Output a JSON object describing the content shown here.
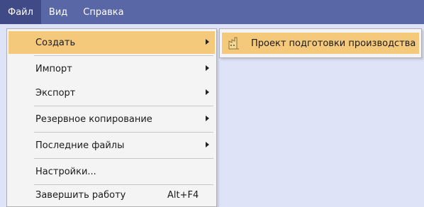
{
  "menubar": {
    "items": [
      {
        "label": "Файл"
      },
      {
        "label": "Вид"
      },
      {
        "label": "Справка"
      }
    ]
  },
  "file_menu": {
    "items": [
      {
        "label": "Создать",
        "shortcut": "",
        "has_submenu": true
      },
      {
        "label": "Импорт",
        "shortcut": "",
        "has_submenu": true
      },
      {
        "label": "Экспорт",
        "shortcut": "",
        "has_submenu": true
      },
      {
        "label": "Резервное копирование",
        "shortcut": "",
        "has_submenu": true
      },
      {
        "label": "Последние файлы",
        "shortcut": "",
        "has_submenu": true
      },
      {
        "label": "Настройки...",
        "shortcut": "",
        "has_submenu": false
      },
      {
        "label": "Завершить работу",
        "shortcut": "Alt+F4",
        "has_submenu": false
      }
    ]
  },
  "create_submenu": {
    "items": [
      {
        "label": "Проект подготовки производства",
        "icon": "factory-document-icon"
      }
    ]
  },
  "colors": {
    "menubar": "#5a67a6",
    "menubar_active": "#3f4a86",
    "highlight": "#f5c97c",
    "workspace": "#dfe3f7",
    "menu_bg": "#f4f4f4"
  }
}
